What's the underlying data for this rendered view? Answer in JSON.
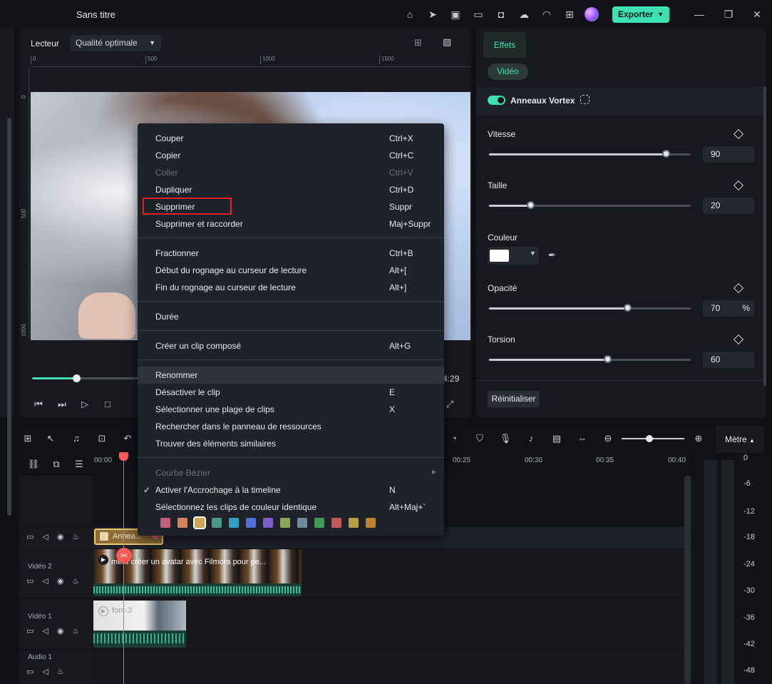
{
  "app": {
    "title": "Sans titre",
    "export_label": "Exporter"
  },
  "player": {
    "label": "Lecteur",
    "quality": "Qualité optimale",
    "ruler_top": [
      "0",
      "500",
      "1000",
      "1500"
    ],
    "ruler_left": [
      "0",
      "500",
      "1000"
    ],
    "time_end": "4:29",
    "progress": 0.42
  },
  "effects": {
    "tab": "Effets",
    "filter": "Vidéo",
    "effect_name": "Anneaux Vortex",
    "params": [
      {
        "label": "Vitesse",
        "value": "90",
        "unit": "",
        "fraction": 0.88
      },
      {
        "label": "Taille",
        "value": "20",
        "unit": "",
        "fraction": 0.21
      },
      {
        "label": "Opacité",
        "value": "70",
        "unit": "%",
        "fraction": 0.69
      },
      {
        "label": "Torsion",
        "value": "60",
        "unit": "",
        "fraction": 0.59
      }
    ],
    "color_label": "Couleur",
    "color_value": "#ffffff",
    "reset_label": "Réinitialiser"
  },
  "timeline": {
    "meter_label": "Mètre",
    "ticks": [
      "00:00",
      "00:25",
      "00:30",
      "00:35",
      "00:40"
    ],
    "tracks": {
      "video2": "Vidéo 2",
      "video1": "Vidéo 1",
      "audio1": "Audio 1"
    },
    "effect_clip_label": "Annea...",
    "clip_v2_label": "ment créer un avatar avec Filmora pour pe...",
    "clip_v1_label": "font-3",
    "meter_levels": [
      "0",
      "-6",
      "-12",
      "-18",
      "-24",
      "-30",
      "-36",
      "-42",
      "-48"
    ]
  },
  "context_menu": {
    "items": [
      {
        "label": "Couper",
        "shortcut": "Ctrl+X",
        "disabled": false
      },
      {
        "label": "Copier",
        "shortcut": "Ctrl+C",
        "disabled": false
      },
      {
        "label": "Coller",
        "shortcut": "Ctrl+V",
        "disabled": true
      },
      {
        "label": "Dupliquer",
        "shortcut": "Ctrl+D",
        "disabled": false
      },
      {
        "label": "Supprimer",
        "shortcut": "Suppr",
        "disabled": false
      },
      {
        "label": "Supprimer et raccorder",
        "shortcut": "Maj+Suppr",
        "disabled": false
      },
      {
        "label": "Fractionner",
        "shortcut": "Ctrl+B",
        "disabled": false
      },
      {
        "label": "Début du rognage au curseur de lecture",
        "shortcut": "Alt+[",
        "disabled": false
      },
      {
        "label": "Fin du rognage au curseur de lecture",
        "shortcut": "Alt+]",
        "disabled": false
      },
      {
        "label": "Durée",
        "shortcut": "",
        "disabled": false
      },
      {
        "label": "Créer un clip composé",
        "shortcut": "Alt+G",
        "disabled": false
      },
      {
        "label": "Renommer",
        "shortcut": "",
        "disabled": false
      },
      {
        "label": "Désactiver le clip",
        "shortcut": "E",
        "disabled": false
      },
      {
        "label": "Sélectionner une plage de clips",
        "shortcut": "X",
        "disabled": false
      },
      {
        "label": "Rechercher dans le panneau de ressources",
        "shortcut": "",
        "disabled": false
      },
      {
        "label": "Trouver des éléments similaires",
        "shortcut": "",
        "disabled": false
      },
      {
        "label": "Courbe Bézier",
        "shortcut": "",
        "disabled": true
      },
      {
        "label": "Activer l'Accrochage à la timeline",
        "shortcut": "N",
        "disabled": false
      },
      {
        "label": "Sélectionnez les clips de couleur identique",
        "shortcut": "Alt+Maj+`",
        "disabled": false
      }
    ],
    "swatches": [
      "#c2607a",
      "#d4845a",
      "#d0a456",
      "#4a9a86",
      "#2ea0c0",
      "#4f6fd8",
      "#7a5cc8",
      "#8aa85a",
      "#6f8a9a",
      "#3f9a58",
      "#c25a5a",
      "#b8a040",
      "#b8842e"
    ],
    "selected_swatch": 2
  }
}
